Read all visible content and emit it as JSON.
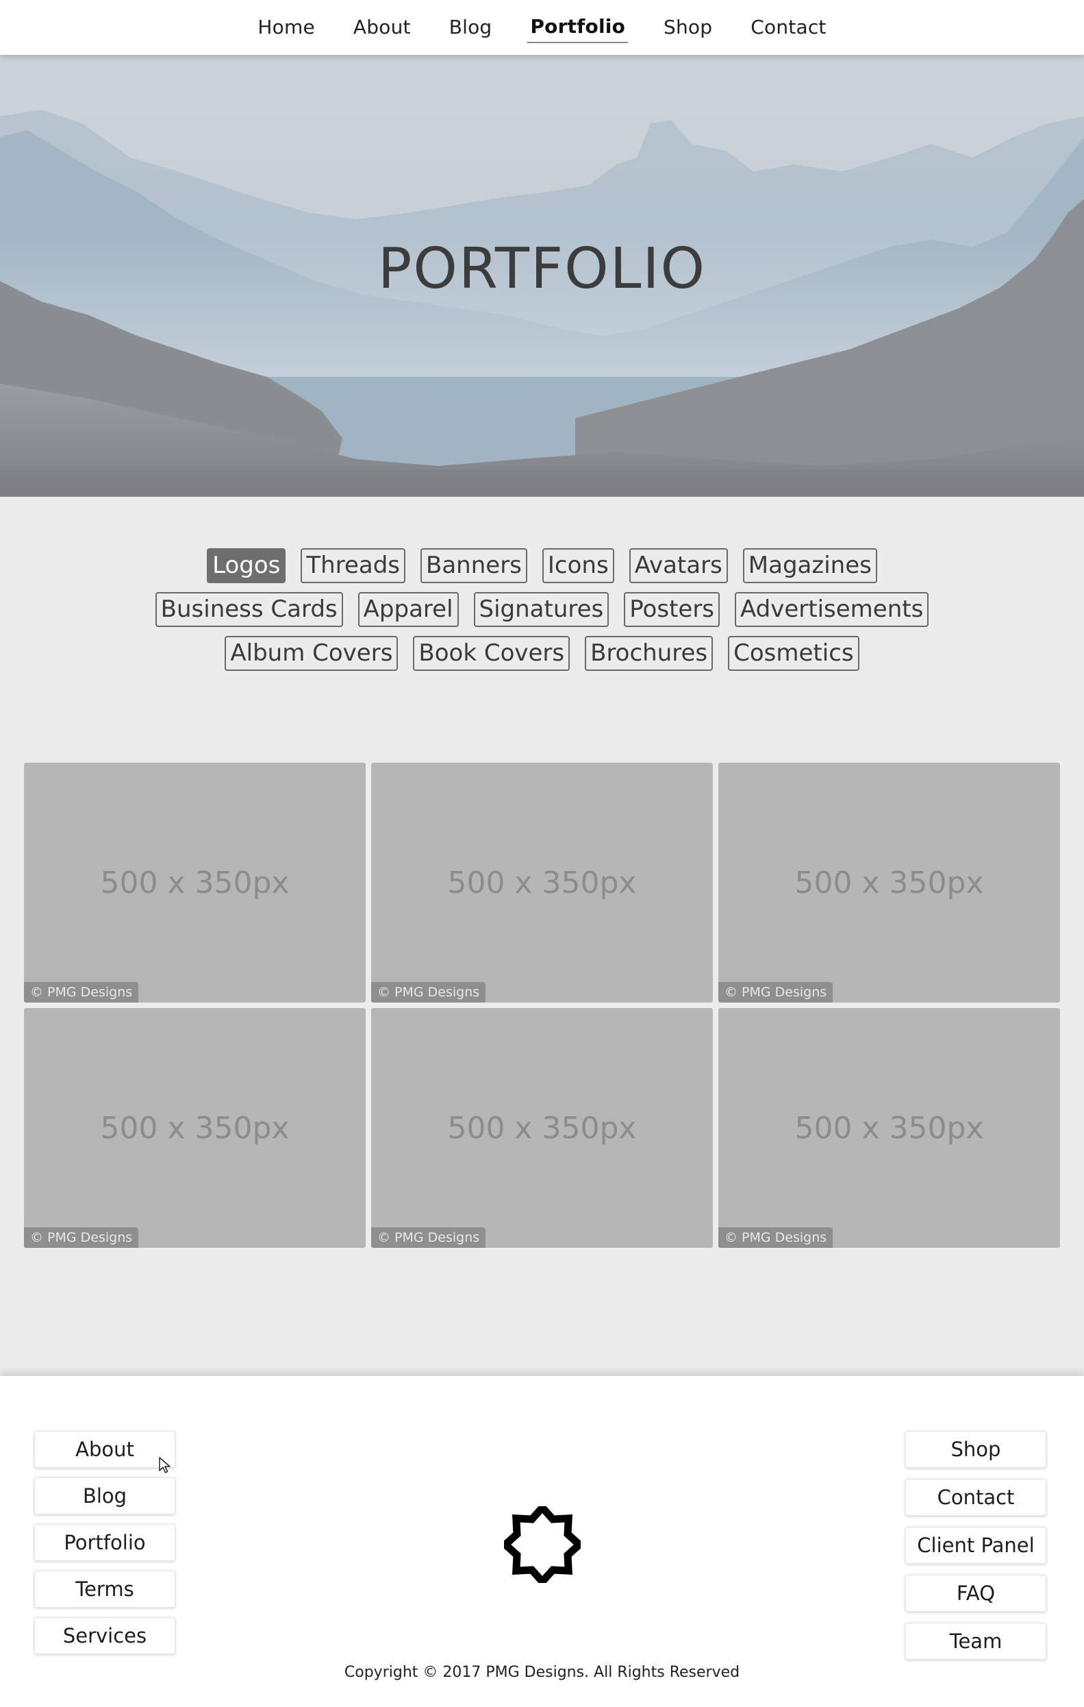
{
  "nav": {
    "items": [
      {
        "label": "Home",
        "active": false
      },
      {
        "label": "About",
        "active": false
      },
      {
        "label": "Blog",
        "active": false
      },
      {
        "label": "Portfolio",
        "active": true
      },
      {
        "label": "Shop",
        "active": false
      },
      {
        "label": "Contact",
        "active": false
      }
    ]
  },
  "hero": {
    "title": "PORTFOLIO"
  },
  "filters": [
    {
      "label": "Logos",
      "active": true
    },
    {
      "label": "Threads",
      "active": false
    },
    {
      "label": "Banners",
      "active": false
    },
    {
      "label": "Icons",
      "active": false
    },
    {
      "label": "Avatars",
      "active": false
    },
    {
      "label": "Magazines",
      "active": false
    },
    {
      "label": "Business Cards",
      "active": false
    },
    {
      "label": "Apparel",
      "active": false
    },
    {
      "label": "Signatures",
      "active": false
    },
    {
      "label": "Posters",
      "active": false
    },
    {
      "label": "Advertisements",
      "active": false
    },
    {
      "label": "Album Covers",
      "active": false
    },
    {
      "label": "Book Covers",
      "active": false
    },
    {
      "label": "Brochures",
      "active": false
    },
    {
      "label": "Cosmetics",
      "active": false
    }
  ],
  "gallery": {
    "tiles": [
      {
        "placeholder": "500 x 350px",
        "credit": "© PMG Designs"
      },
      {
        "placeholder": "500 x 350px",
        "credit": "© PMG Designs"
      },
      {
        "placeholder": "500 x 350px",
        "credit": "© PMG Designs"
      },
      {
        "placeholder": "500 x 350px",
        "credit": "© PMG Designs"
      },
      {
        "placeholder": "500 x 350px",
        "credit": "© PMG Designs"
      },
      {
        "placeholder": "500 x 350px",
        "credit": "© PMG Designs"
      }
    ]
  },
  "footer": {
    "left_links": [
      "About",
      "Blog",
      "Portfolio",
      "Terms",
      "Services"
    ],
    "right_links": [
      "Shop",
      "Contact",
      "Client Panel",
      "FAQ",
      "Team"
    ],
    "logo_icon": "star-logo-icon",
    "copyright": "Copyright © 2017 PMG Designs. All Rights Reserved"
  },
  "colors": {
    "active_filter_bg": "#6e6e6e",
    "tile_bg": "#b6b6b6",
    "page_bg": "#ececec"
  }
}
